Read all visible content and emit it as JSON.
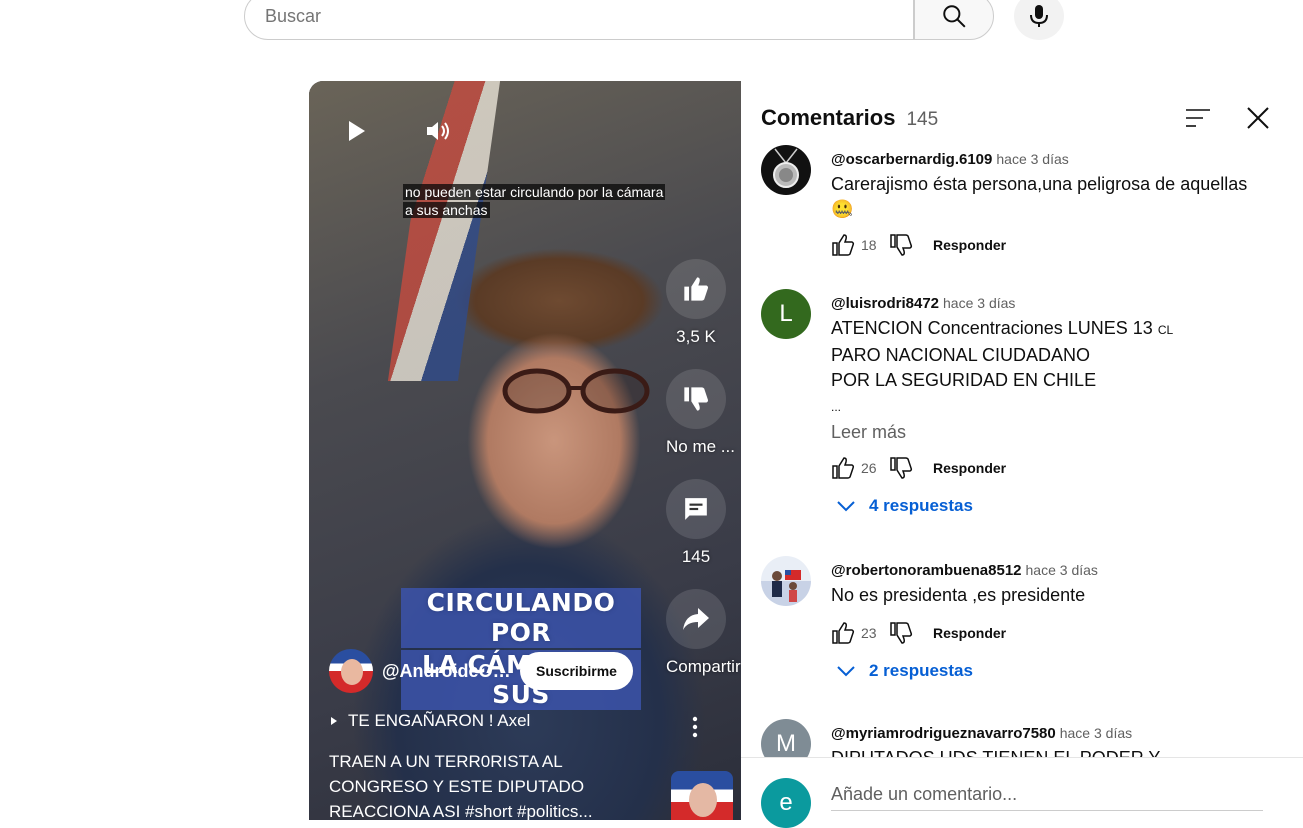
{
  "search": {
    "placeholder": "Buscar"
  },
  "video": {
    "caption_line1": "no pueden estar circulando por la cámara",
    "caption_line2": "a sus anchas",
    "banner_line1": "CIRCULANDO POR",
    "banner_line2": "LA CÁMARA A SUS",
    "likes": "3,5 K",
    "dislike_label": "No me ...",
    "comments_count": "145",
    "share_label": "Compartir",
    "channel": "@AndroideOfficial",
    "subscribe_label": "Suscribirme",
    "playlist": "TE ENGAÑARON ! Axel",
    "title": "TRAEN A UN TERR0RISTA AL CONGRESO Y ESTE DIPUTADO REACCIONA ASI #short #politics..."
  },
  "comments_panel": {
    "title": "Comentarios",
    "count": "145",
    "reply_label": "Responder",
    "read_more": "Leer más",
    "add_placeholder": "Añade un comentario...",
    "current_user_initial": "e",
    "items": [
      {
        "user": "@oscarbernardig.6109",
        "time": "hace 3 días",
        "text": "Carerajismo ésta persona,una peligrosa de aquellas",
        "emoji": "🤐",
        "likes": "18"
      },
      {
        "user": "@luisrodri8472",
        "time": "hace 3 días",
        "initial": "L",
        "text1": "ATENCION Concentraciones LUNES 13",
        "flag": "CL",
        "text2": "PARO NACIONAL CIUDADANO",
        "text3": "POR LA SEGURIDAD EN CHILE",
        "ellipsis": "...",
        "likes": "26",
        "replies": "4 respuestas"
      },
      {
        "user": "@robertonorambuena8512",
        "time": "hace 3 días",
        "text": "No es presidenta ,es presidente",
        "likes": "23",
        "replies": "2 respuestas"
      },
      {
        "user": "@myriamrodrigueznavarro7580",
        "time": "hace 3 días",
        "initial": "M",
        "text": "DIPUTADOS UDS TIENEN EL PODER Y AUTORIDAD"
      }
    ]
  },
  "colors": {
    "link_blue": "#065fd4",
    "avatar_green": "#33691e",
    "avatar_teal": "#0b9a9e",
    "avatar_gray": "#7f8c95"
  }
}
